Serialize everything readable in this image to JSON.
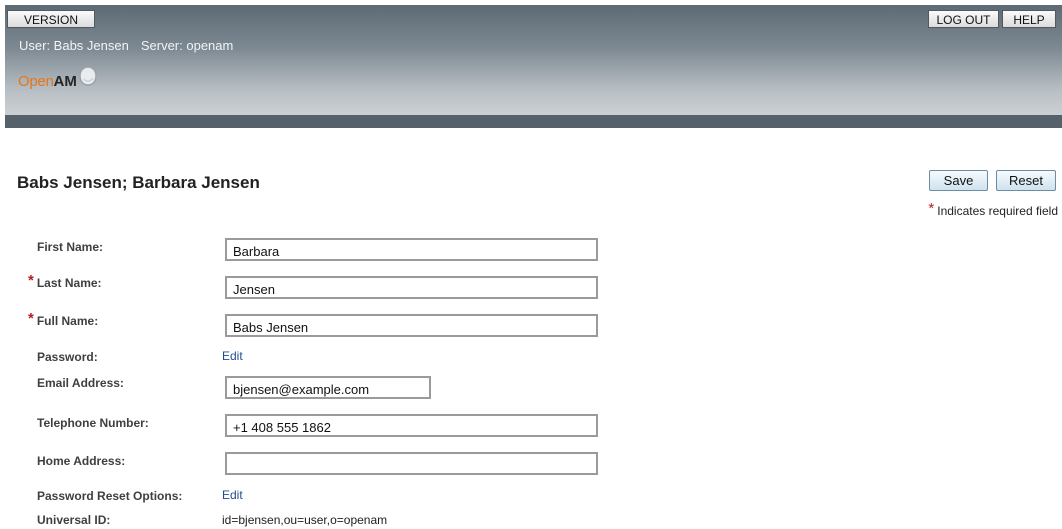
{
  "masthead": {
    "version_label": "VERSION",
    "logout_label": "LOG OUT",
    "help_label": "HELP",
    "user_text": "User: Babs Jensen",
    "server_text": "Server: openam",
    "logo": {
      "part1": "Open",
      "part2": "AM",
      "accent": "#e4761c"
    }
  },
  "page": {
    "title": "Babs Jensen; Barbara Jensen",
    "save_label": "Save",
    "reset_label": "Reset",
    "required_note": "Indicates required field"
  },
  "form": {
    "first_name": {
      "label": "First Name:",
      "value": "Barbara"
    },
    "last_name": {
      "label": "Last Name:",
      "value": "Jensen",
      "required": true
    },
    "full_name": {
      "label": "Full Name:",
      "value": "Babs Jensen",
      "required": true
    },
    "password": {
      "label": "Password:",
      "link": "Edit"
    },
    "email": {
      "label": "Email Address:",
      "value": "bjensen@example.com"
    },
    "telephone": {
      "label": "Telephone Number:",
      "value": "+1 408 555 1862"
    },
    "home_address": {
      "label": "Home Address:",
      "value": ""
    },
    "password_reset": {
      "label": "Password Reset Options:",
      "link": "Edit"
    },
    "universal_id": {
      "label": "Universal ID:",
      "value": "id=bjensen,ou=user,o=openam"
    }
  }
}
